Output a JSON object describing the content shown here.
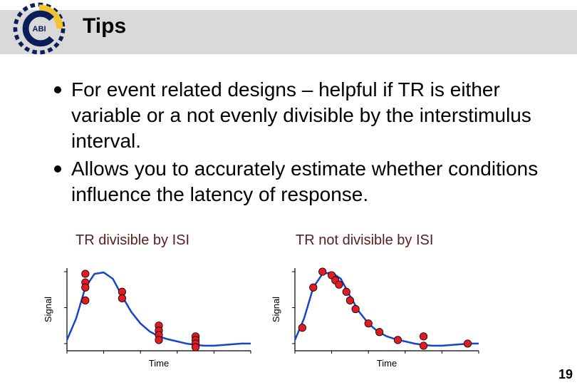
{
  "logo": {
    "text": "ABI"
  },
  "header": {
    "title": "Tips"
  },
  "bullets": [
    "For event related designs – helpful if TR is either variable or a not evenly divisible by the interstimulus interval.",
    "Allows you to accurately estimate whether conditions influence the latency of response."
  ],
  "captions": {
    "left": "TR divisible by ISI",
    "right": "TR not divisible by ISI"
  },
  "page_number": "19",
  "chart_data": [
    {
      "type": "line",
      "title": "TR divisible by ISI",
      "xlabel": "Time",
      "ylabel": "Signal",
      "xlim": [
        0,
        10
      ],
      "ylim": [
        0,
        1
      ],
      "curve": [
        {
          "x": 0.0,
          "y": 0.05
        },
        {
          "x": 0.5,
          "y": 0.35
        },
        {
          "x": 1.0,
          "y": 0.78
        },
        {
          "x": 1.5,
          "y": 0.97
        },
        {
          "x": 2.0,
          "y": 0.99
        },
        {
          "x": 2.5,
          "y": 0.9
        },
        {
          "x": 3.0,
          "y": 0.66
        },
        {
          "x": 3.5,
          "y": 0.44
        },
        {
          "x": 4.0,
          "y": 0.28
        },
        {
          "x": 4.5,
          "y": 0.17
        },
        {
          "x": 5.0,
          "y": 0.1
        },
        {
          "x": 5.5,
          "y": 0.06
        },
        {
          "x": 6.0,
          "y": 0.03
        },
        {
          "x": 6.5,
          "y": 0.0
        },
        {
          "x": 7.0,
          "y": -0.02
        },
        {
          "x": 7.5,
          "y": -0.03
        },
        {
          "x": 8.0,
          "y": -0.03
        },
        {
          "x": 8.5,
          "y": -0.02
        },
        {
          "x": 9.0,
          "y": -0.01
        },
        {
          "x": 9.5,
          "y": 0.0
        },
        {
          "x": 10.0,
          "y": 0.0
        }
      ],
      "points": [
        {
          "x": 1.0,
          "y": 0.97
        },
        {
          "x": 1.0,
          "y": 0.85
        },
        {
          "x": 1.0,
          "y": 0.78
        },
        {
          "x": 1.0,
          "y": 0.6
        },
        {
          "x": 3.0,
          "y": 0.72
        },
        {
          "x": 3.0,
          "y": 0.63
        },
        {
          "x": 5.0,
          "y": 0.25
        },
        {
          "x": 5.0,
          "y": 0.18
        },
        {
          "x": 5.0,
          "y": 0.12
        },
        {
          "x": 5.0,
          "y": 0.05
        },
        {
          "x": 7.0,
          "y": 0.1
        },
        {
          "x": 7.0,
          "y": 0.05
        },
        {
          "x": 7.0,
          "y": 0.0
        },
        {
          "x": 7.0,
          "y": -0.05
        }
      ]
    },
    {
      "type": "line",
      "title": "TR not divisible by ISI",
      "xlabel": "Time",
      "ylabel": "Signal",
      "xlim": [
        0,
        10
      ],
      "ylim": [
        0,
        1
      ],
      "curve": [
        {
          "x": 0.0,
          "y": 0.05
        },
        {
          "x": 0.5,
          "y": 0.35
        },
        {
          "x": 1.0,
          "y": 0.78
        },
        {
          "x": 1.5,
          "y": 0.97
        },
        {
          "x": 2.0,
          "y": 0.99
        },
        {
          "x": 2.5,
          "y": 0.9
        },
        {
          "x": 3.0,
          "y": 0.66
        },
        {
          "x": 3.5,
          "y": 0.44
        },
        {
          "x": 4.0,
          "y": 0.28
        },
        {
          "x": 4.5,
          "y": 0.17
        },
        {
          "x": 5.0,
          "y": 0.1
        },
        {
          "x": 5.5,
          "y": 0.06
        },
        {
          "x": 6.0,
          "y": 0.03
        },
        {
          "x": 6.5,
          "y": 0.0
        },
        {
          "x": 7.0,
          "y": -0.02
        },
        {
          "x": 7.5,
          "y": -0.03
        },
        {
          "x": 8.0,
          "y": -0.03
        },
        {
          "x": 8.5,
          "y": -0.02
        },
        {
          "x": 9.0,
          "y": -0.01
        },
        {
          "x": 9.5,
          "y": 0.0
        },
        {
          "x": 10.0,
          "y": 0.0
        }
      ],
      "points": [
        {
          "x": 0.4,
          "y": 0.22
        },
        {
          "x": 1.0,
          "y": 0.78
        },
        {
          "x": 1.5,
          "y": 1.0
        },
        {
          "x": 2.0,
          "y": 0.95
        },
        {
          "x": 2.2,
          "y": 0.88
        },
        {
          "x": 2.4,
          "y": 0.82
        },
        {
          "x": 2.8,
          "y": 0.72
        },
        {
          "x": 3.0,
          "y": 0.6
        },
        {
          "x": 3.3,
          "y": 0.48
        },
        {
          "x": 4.0,
          "y": 0.28
        },
        {
          "x": 4.6,
          "y": 0.16
        },
        {
          "x": 5.6,
          "y": 0.05
        },
        {
          "x": 7.0,
          "y": 0.1
        },
        {
          "x": 7.0,
          "y": -0.03
        },
        {
          "x": 9.4,
          "y": 0.0
        }
      ]
    }
  ],
  "colors": {
    "curve": "#1844c9",
    "point_fill": "#e01b24",
    "point_stroke": "#000000",
    "axis": "#000000",
    "caption": "#5b1d1d"
  }
}
